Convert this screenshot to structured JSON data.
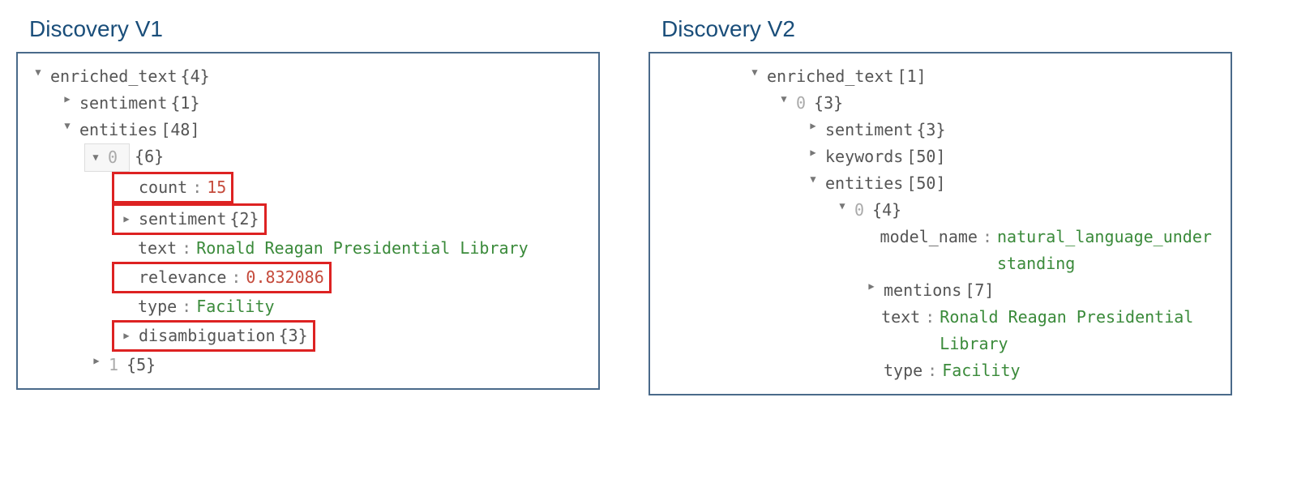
{
  "left": {
    "title": "Discovery V1",
    "root": {
      "key": "enriched_text",
      "meta": "{4}"
    },
    "sentiment": {
      "key": "sentiment",
      "meta": "{1}"
    },
    "entities": {
      "key": "entities",
      "meta": "[48]"
    },
    "entity0": {
      "idx": "0",
      "meta": "{6}"
    },
    "count": {
      "key": "count",
      "value": "15"
    },
    "inner_sentiment": {
      "key": "sentiment",
      "meta": "{2}"
    },
    "text": {
      "key": "text",
      "value": "Ronald Reagan Presidential Library"
    },
    "relevance": {
      "key": "relevance",
      "value": "0.832086"
    },
    "type": {
      "key": "type",
      "value": "Facility"
    },
    "disambiguation": {
      "key": "disambiguation",
      "meta": "{3}"
    },
    "entity1": {
      "idx": "1",
      "meta": "{5}"
    }
  },
  "right": {
    "title": "Discovery V2",
    "root": {
      "key": "enriched_text",
      "meta": "[1]"
    },
    "idx0": {
      "idx": "0",
      "meta": "{3}"
    },
    "sentiment": {
      "key": "sentiment",
      "meta": "{3}"
    },
    "keywords": {
      "key": "keywords",
      "meta": "[50]"
    },
    "entities": {
      "key": "entities",
      "meta": "[50]"
    },
    "entity0": {
      "idx": "0",
      "meta": "{4}"
    },
    "model_name": {
      "key": "model_name",
      "value": "natural_language_understanding"
    },
    "mentions": {
      "key": "mentions",
      "meta": "[7]"
    },
    "text": {
      "key": "text",
      "value": "Ronald Reagan Presidential Library"
    },
    "type": {
      "key": "type",
      "value": "Facility"
    }
  }
}
